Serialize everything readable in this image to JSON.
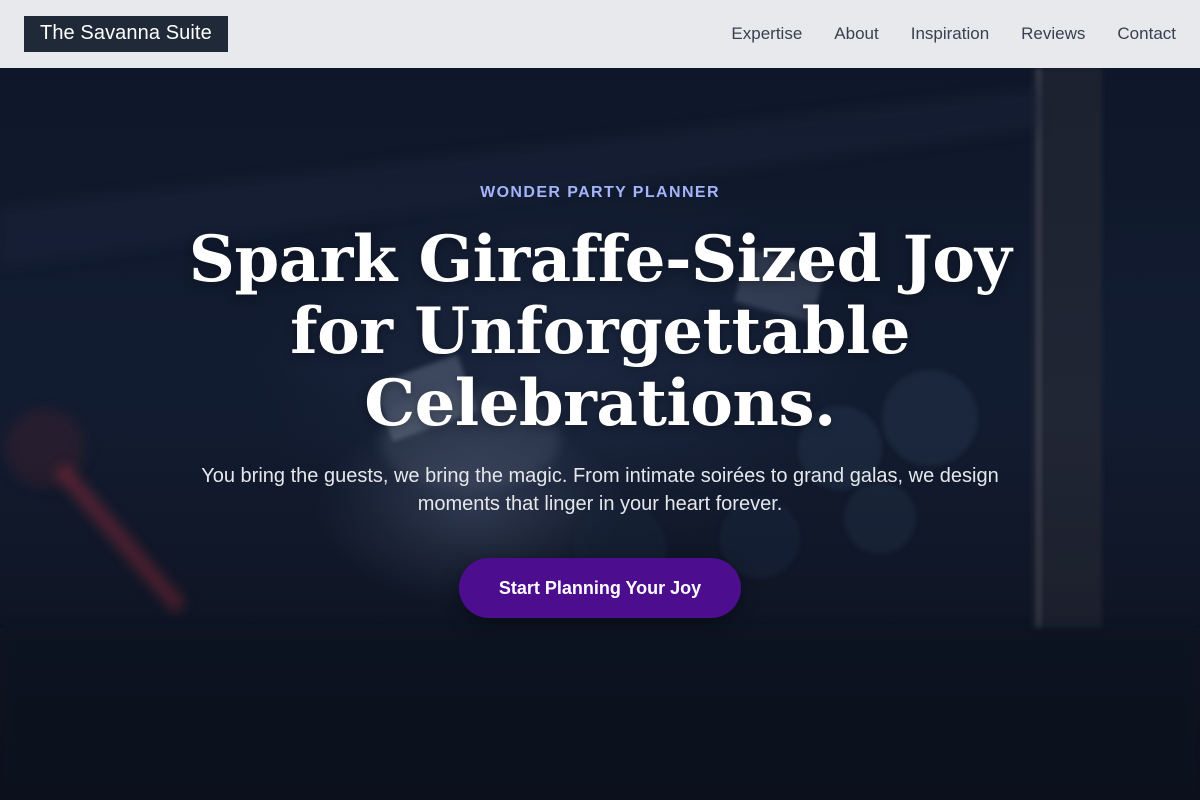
{
  "header": {
    "brand": "The Savanna Suite",
    "nav": [
      {
        "label": "Expertise"
      },
      {
        "label": "About"
      },
      {
        "label": "Inspiration"
      },
      {
        "label": "Reviews"
      },
      {
        "label": "Contact"
      }
    ]
  },
  "hero": {
    "eyebrow": "WONDER PARTY PLANNER",
    "headline": "Spark Giraffe-Sized Joy for Unforgettable Celebrations.",
    "subtext": "You bring the guests, we bring the magic. From intimate soirées to grand galas, we design moments that linger in your heart forever.",
    "cta_label": "Start Planning Your Joy"
  },
  "colors": {
    "header_bg": "#e8e9ec",
    "logo_bg": "#1f2937",
    "eyebrow": "#a5b4fc",
    "cta_bg": "#4c0d8f"
  }
}
